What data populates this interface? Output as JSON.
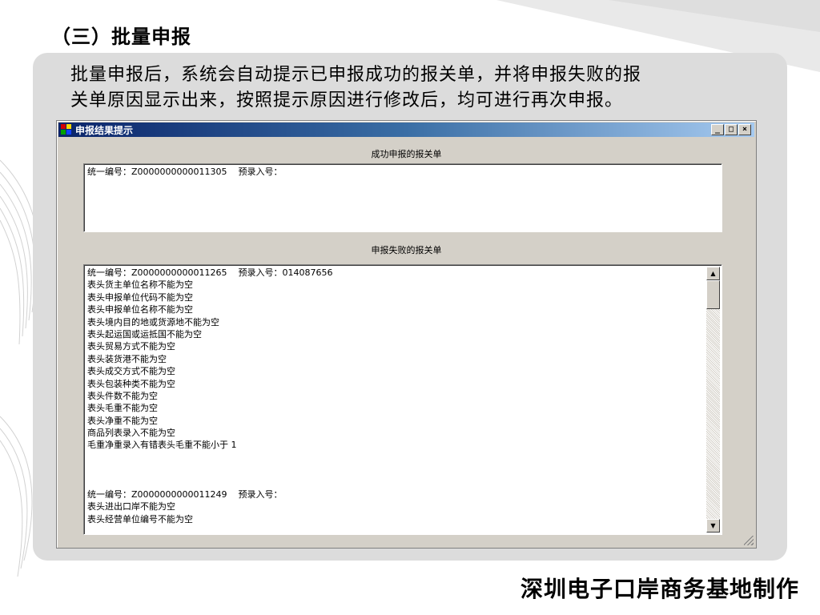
{
  "slide": {
    "title": "（三）批量申报",
    "intro_line1": "批量申报后，系统会自动提示已申报成功的报关单，并将申报失败的报",
    "intro_line2": "关单原因显示出来，按照提示原因进行修改后，均可进行再次申报。",
    "footer": "深圳电子口岸商务基地制作"
  },
  "window": {
    "title": "申报结果提示",
    "minimize_glyph": "_",
    "maximize_glyph": "□",
    "close_glyph": "×",
    "success_label": "成功申报的报关单",
    "failure_label": "申报失败的报关单",
    "success_lines": [
      "统一编号：Z0000000000011305    预录入号："
    ],
    "failure_lines": [
      "统一编号：Z0000000000011265    预录入号：014087656",
      "表头货主单位名称不能为空",
      "表头申报单位代码不能为空",
      "表头申报单位名称不能为空",
      "表头境内目的地或货源地不能为空",
      "表头起运国或运抵国不能为空",
      "表头贸易方式不能为空",
      "表头装货港不能为空",
      "表头成交方式不能为空",
      "表头包装种类不能为空",
      "表头件数不能为空",
      "表头毛重不能为空",
      "表头净重不能为空",
      "商品列表录入不能为空",
      "毛重净重录入有错表头毛重不能小于 1",
      "",
      "",
      "",
      "统一编号：Z0000000000011249    预录入号：",
      "表头进出口岸不能为空",
      "表头经营单位编号不能为空"
    ],
    "scroll_up_glyph": "▲",
    "scroll_down_glyph": "▼"
  },
  "colors": {
    "panel": "#dcdcdc",
    "title_bar_start": "#0a246a",
    "title_bar_end": "#a6caf0",
    "window_face": "#d4d0c8"
  }
}
